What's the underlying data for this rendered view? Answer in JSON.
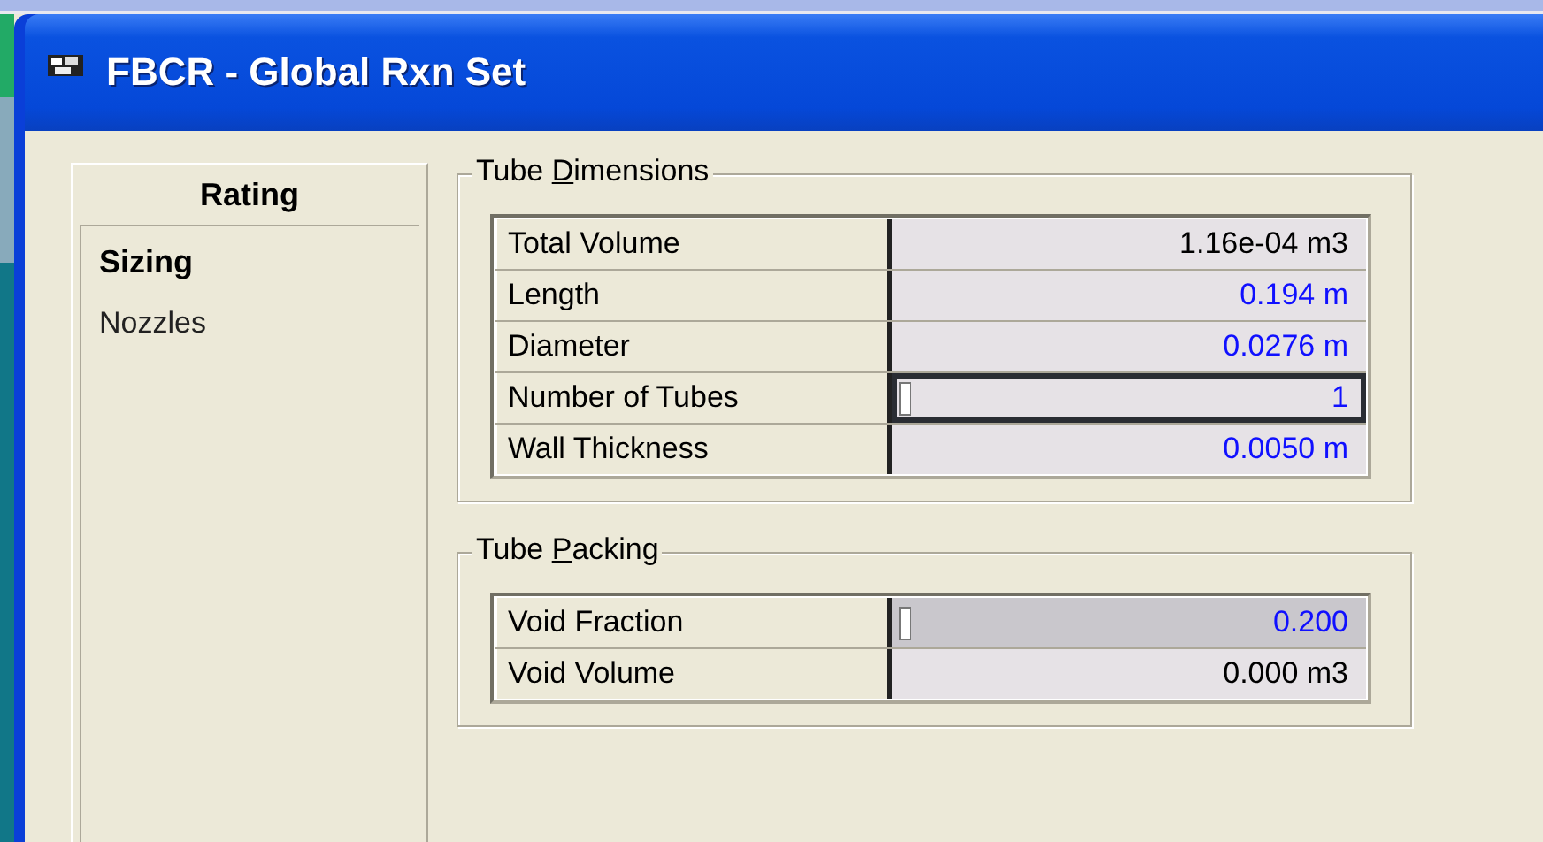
{
  "window": {
    "title": "FBCR - Global Rxn Set"
  },
  "sidebar": {
    "header": "Rating",
    "items": [
      {
        "label": "Sizing",
        "selected": true
      },
      {
        "label": "Nozzles",
        "selected": false
      }
    ]
  },
  "groups": [
    {
      "title": {
        "before": "Tube ",
        "key": "D",
        "after": "imensions"
      },
      "rows": [
        {
          "label": "Total Volume",
          "value": "1.16e-04 m3",
          "kind": "calculated",
          "focused": false,
          "selected": false
        },
        {
          "label": "Length",
          "value": "0.194 m",
          "kind": "input",
          "focused": false,
          "selected": false
        },
        {
          "label": "Diameter",
          "value": "0.0276 m",
          "kind": "input",
          "focused": false,
          "selected": false
        },
        {
          "label": "Number of Tubes",
          "value": "1",
          "kind": "input",
          "focused": true,
          "selected": false
        },
        {
          "label": "Wall Thickness",
          "value": "0.0050 m",
          "kind": "input",
          "focused": false,
          "selected": false
        }
      ]
    },
    {
      "title": {
        "before": "Tube ",
        "key": "P",
        "after": "acking"
      },
      "rows": [
        {
          "label": "Void Fraction",
          "value": "0.200",
          "kind": "input",
          "focused": false,
          "selected": true
        },
        {
          "label": "Void Volume",
          "value": "0.000 m3",
          "kind": "calculated",
          "focused": false,
          "selected": false
        }
      ]
    }
  ]
}
